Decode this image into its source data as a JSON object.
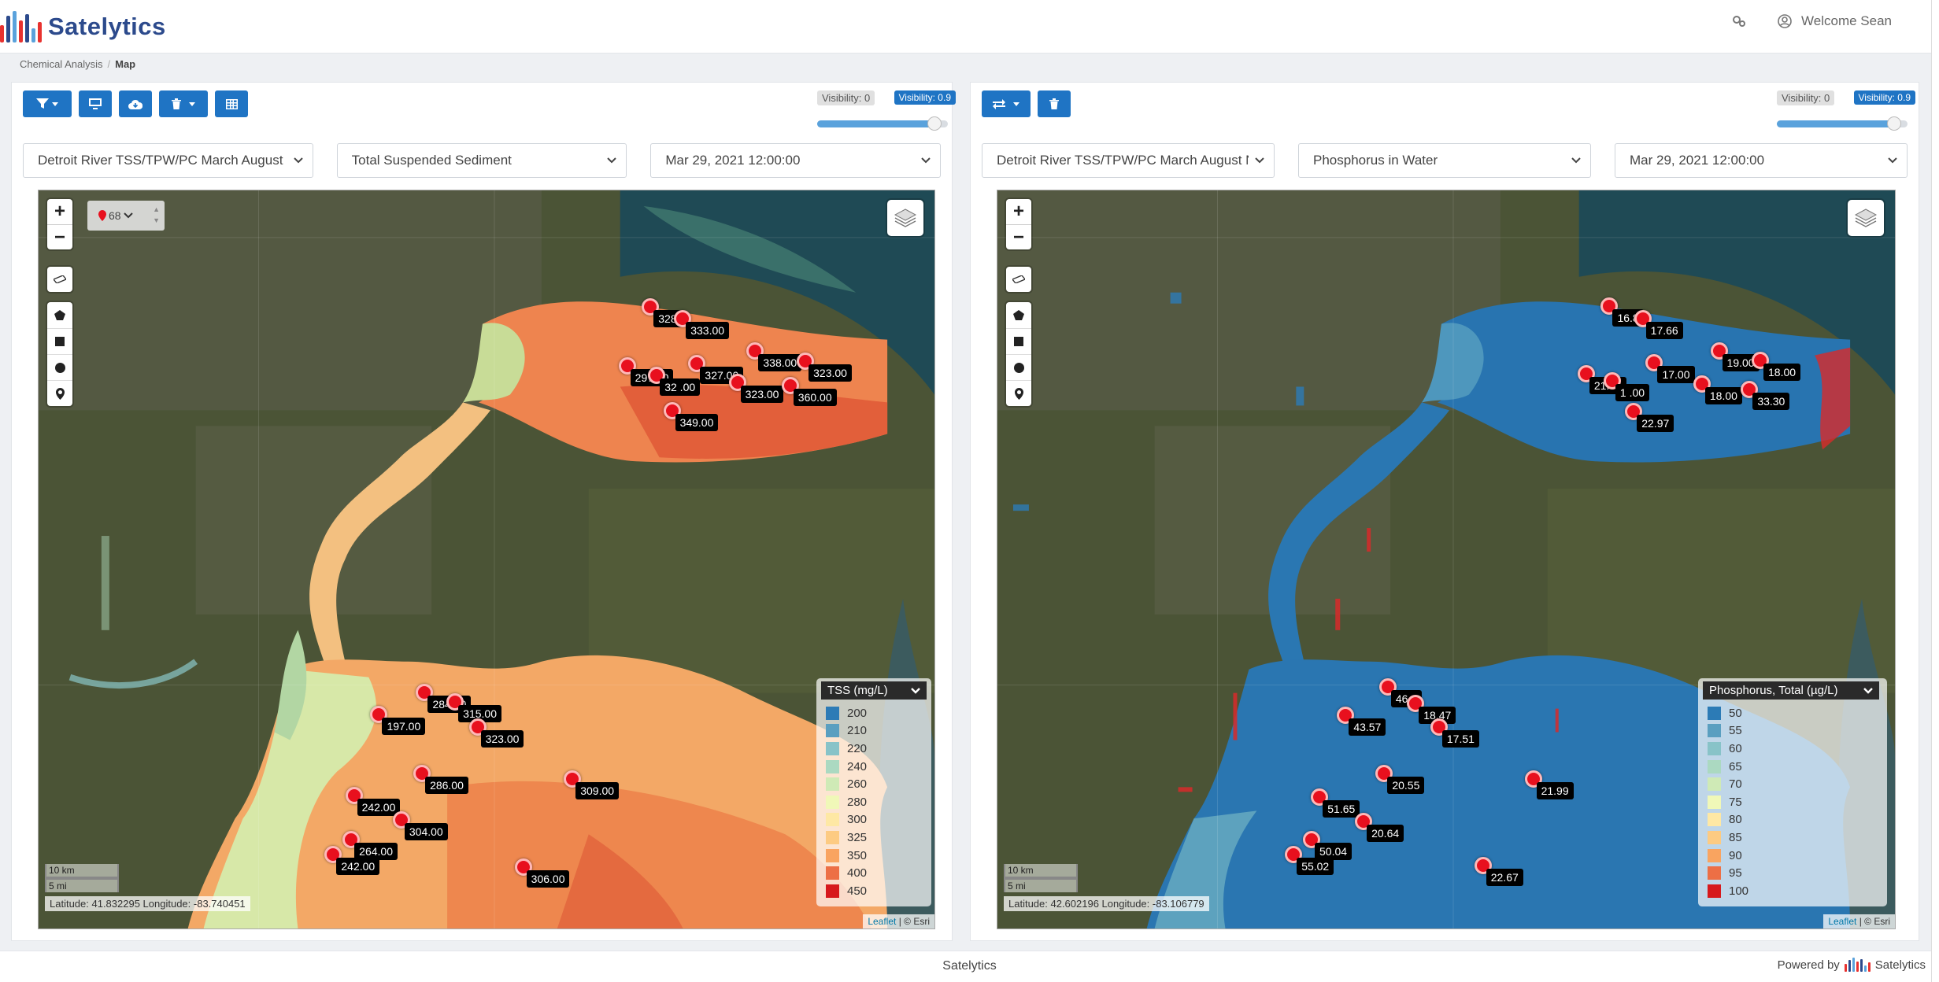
{
  "header": {
    "brand": "Satelytics",
    "welcome": "Welcome Sean",
    "brand_colors": [
      "#e8322f",
      "#2c4a8c",
      "#5aa2dc",
      "#e8322f",
      "#2c4a8c",
      "#5aa2dc",
      "#e8322f"
    ]
  },
  "breadcrumb": {
    "parent": "Chemical Analysis",
    "current": "Map"
  },
  "left": {
    "visibility_min": "Visibility: 0",
    "visibility_max": "Visibility: 0.9",
    "visibility_value": 0.9,
    "project": "Detroit River TSS/TPW/PC March August N",
    "parameter": "Total Suspended Sediment",
    "date": "Mar 29, 2021 12:00:00",
    "pin_count": "68",
    "scale_km": "10 km",
    "scale_mi": "5 mi",
    "coords": "Latitude: 41.832295 Longitude: -83.740451",
    "legend_title": "TSS (mg/L)",
    "legend": [
      {
        "label": "200",
        "color": "#2c7bb6"
      },
      {
        "label": "210",
        "color": "#5a9fc0"
      },
      {
        "label": "220",
        "color": "#88c3c8"
      },
      {
        "label": "240",
        "color": "#abd9c1"
      },
      {
        "label": "260",
        "color": "#cfeab6"
      },
      {
        "label": "280",
        "color": "#f0f8b8"
      },
      {
        "label": "300",
        "color": "#fee8a4"
      },
      {
        "label": "325",
        "color": "#fdcb82"
      },
      {
        "label": "350",
        "color": "#f9a460"
      },
      {
        "label": "400",
        "color": "#ed6f45"
      },
      {
        "label": "450",
        "color": "#d7191c"
      }
    ],
    "markers": [
      {
        "label": "328.",
        "x": 0.683,
        "y": 0.158
      },
      {
        "label": "333.00",
        "x": 0.719,
        "y": 0.174
      },
      {
        "label": "338.00",
        "x": 0.8,
        "y": 0.218
      },
      {
        "label": "323.00",
        "x": 0.856,
        "y": 0.231
      },
      {
        "label": "297.00",
        "x": 0.657,
        "y": 0.238
      },
      {
        "label": "327.00",
        "x": 0.735,
        "y": 0.235
      },
      {
        "label": "32 .00",
        "x": 0.69,
        "y": 0.251
      },
      {
        "label": "323.00",
        "x": 0.78,
        "y": 0.26
      },
      {
        "label": "360.00",
        "x": 0.839,
        "y": 0.264
      },
      {
        "label": "349.00",
        "x": 0.707,
        "y": 0.298
      },
      {
        "label": "284.00",
        "x": 0.431,
        "y": 0.68
      },
      {
        "label": "197.00",
        "x": 0.38,
        "y": 0.71
      },
      {
        "label": "315.00",
        "x": 0.465,
        "y": 0.693
      },
      {
        "label": "323.00",
        "x": 0.49,
        "y": 0.727
      },
      {
        "label": "286.00",
        "x": 0.428,
        "y": 0.79
      },
      {
        "label": "309.00",
        "x": 0.596,
        "y": 0.797
      },
      {
        "label": "242.00",
        "x": 0.352,
        "y": 0.82
      },
      {
        "label": "304.00",
        "x": 0.405,
        "y": 0.853
      },
      {
        "label": "264.00",
        "x": 0.349,
        "y": 0.879
      },
      {
        "label": "242.00",
        "x": 0.329,
        "y": 0.9
      },
      {
        "label": "306.00",
        "x": 0.541,
        "y": 0.917
      }
    ]
  },
  "right": {
    "visibility_min": "Visibility: 0",
    "visibility_max": "Visibility: 0.9",
    "visibility_value": 0.9,
    "project": "Detroit River TSS/TPW/PC March August N",
    "parameter": "Phosphorus in Water",
    "date": "Mar 29, 2021 12:00:00",
    "scale_km": "10 km",
    "scale_mi": "5 mi",
    "coords": "Latitude: 42.602196 Longitude: -83.106779",
    "legend_title": "Phosphorus, Total (µg/L)",
    "legend": [
      {
        "label": "50",
        "color": "#2c7bb6"
      },
      {
        "label": "55",
        "color": "#5a9fc0"
      },
      {
        "label": "60",
        "color": "#88c3c8"
      },
      {
        "label": "65",
        "color": "#abd9c1"
      },
      {
        "label": "70",
        "color": "#cfeab6"
      },
      {
        "label": "75",
        "color": "#f0f8b8"
      },
      {
        "label": "80",
        "color": "#fee8a4"
      },
      {
        "label": "85",
        "color": "#fdcb82"
      },
      {
        "label": "90",
        "color": "#f9a460"
      },
      {
        "label": "95",
        "color": "#ed6f45"
      },
      {
        "label": "100",
        "color": "#d7191c"
      }
    ],
    "markers": [
      {
        "label": "16.8",
        "x": 0.682,
        "y": 0.157
      },
      {
        "label": "17.66",
        "x": 0.719,
        "y": 0.174
      },
      {
        "label": "19.00",
        "x": 0.804,
        "y": 0.218
      },
      {
        "label": "18.00",
        "x": 0.85,
        "y": 0.23
      },
      {
        "label": "17.00",
        "x": 0.732,
        "y": 0.234
      },
      {
        "label": "21.84",
        "x": 0.656,
        "y": 0.248
      },
      {
        "label": "1 .00",
        "x": 0.685,
        "y": 0.258
      },
      {
        "label": "18.00",
        "x": 0.785,
        "y": 0.262
      },
      {
        "label": "33.30",
        "x": 0.838,
        "y": 0.27
      },
      {
        "label": "22.97",
        "x": 0.709,
        "y": 0.3
      },
      {
        "label": "46.0",
        "x": 0.435,
        "y": 0.673
      },
      {
        "label": "43.57",
        "x": 0.388,
        "y": 0.711
      },
      {
        "label": "18.47",
        "x": 0.466,
        "y": 0.695
      },
      {
        "label": "17.51",
        "x": 0.492,
        "y": 0.727
      },
      {
        "label": "20.55",
        "x": 0.431,
        "y": 0.79
      },
      {
        "label": "21.99",
        "x": 0.597,
        "y": 0.797
      },
      {
        "label": "51.65",
        "x": 0.359,
        "y": 0.822
      },
      {
        "label": "20.64",
        "x": 0.408,
        "y": 0.855
      },
      {
        "label": "50.04",
        "x": 0.35,
        "y": 0.88
      },
      {
        "label": "55.02",
        "x": 0.33,
        "y": 0.9
      },
      {
        "label": "22.67",
        "x": 0.541,
        "y": 0.915
      }
    ]
  },
  "map_attribution": {
    "leaflet": "Leaflet",
    "sep": " | © ",
    "esri": "Esri"
  },
  "footer": {
    "center": "Satelytics",
    "powered": "Powered by",
    "brand": "Satelytics"
  }
}
